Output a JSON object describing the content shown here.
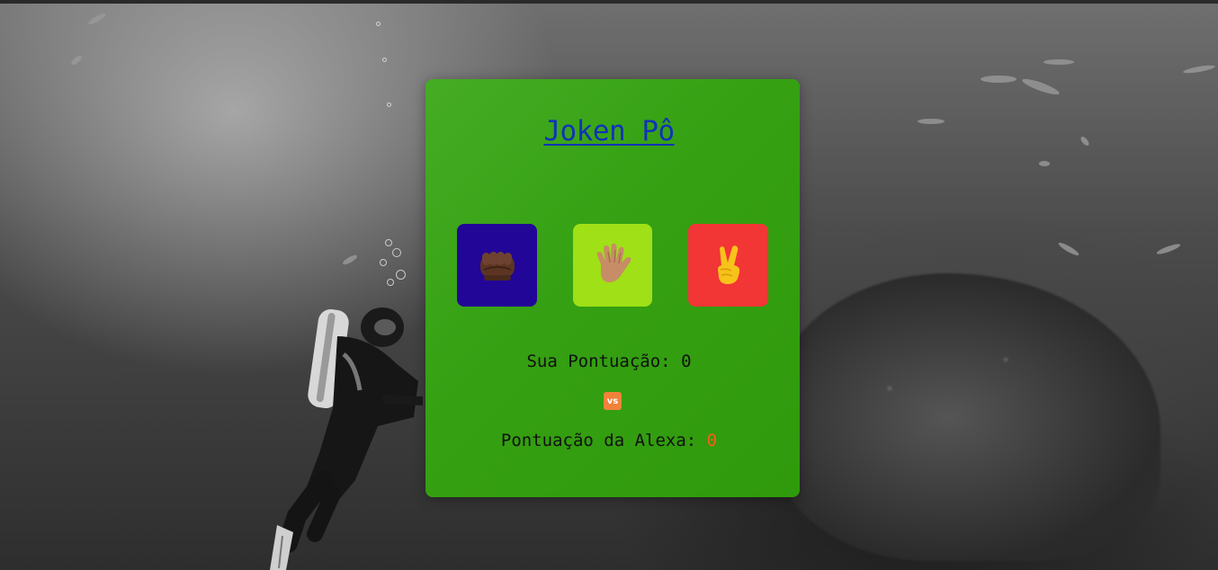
{
  "app": {
    "title": "Joken Pô"
  },
  "choices": [
    {
      "name": "rock",
      "icon": "fist-icon",
      "color": "#220697"
    },
    {
      "name": "paper",
      "icon": "raised-hand-icon",
      "color": "#9fe016"
    },
    {
      "name": "scissors",
      "icon": "victory-hand-icon",
      "color": "#f23535"
    }
  ],
  "score": {
    "player_label": "Sua Pontuação: ",
    "player_value": "0",
    "vs_label": "vs",
    "alexa_label": "Pontuação da Alexa: ",
    "alexa_value": "0"
  },
  "colors": {
    "card": "#35a012",
    "title_link": "#1033b8",
    "alexa_score": "#ff5a1a",
    "vs_badge": "#f2823a"
  },
  "background": {
    "scene": "underwater scuba diver photo (grayscale)"
  }
}
